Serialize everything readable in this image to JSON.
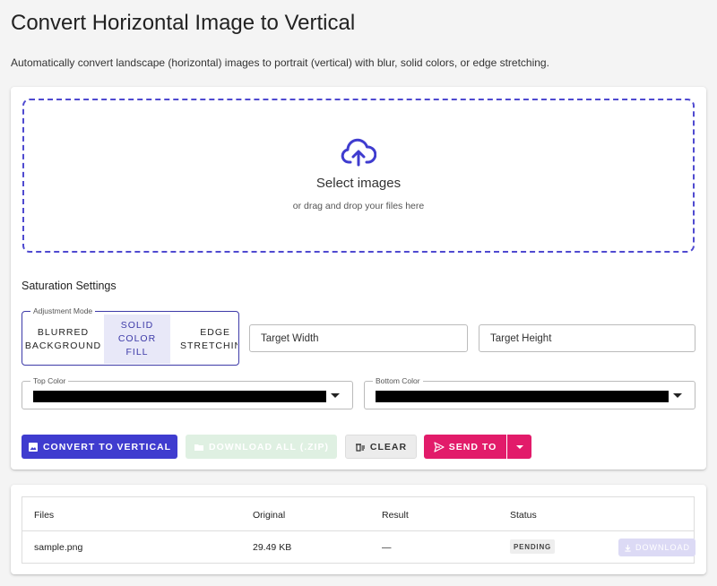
{
  "page": {
    "title": "Convert Horizontal Image to Vertical",
    "subtitle": "Automatically convert landscape (horizontal) images to portrait (vertical) with blur, solid colors, or edge stretching."
  },
  "dropzone": {
    "icon": "cloud-upload-icon",
    "title": "Select images",
    "subtitle": "or drag and drop your files here"
  },
  "settings": {
    "section_label": "Saturation Settings",
    "mode_legend": "Adjustment Mode",
    "modes": [
      {
        "label": "BLURRED\nBACKGROUND",
        "selected": false
      },
      {
        "label": "SOLID\nCOLOR\nFILL",
        "selected": true
      },
      {
        "label": "EDGE\nSTRETCHING",
        "selected": false
      }
    ],
    "target_width_placeholder": "Target Width",
    "target_height_placeholder": "Target Height",
    "top_color_legend": "Top Color",
    "top_color_value": "#000000",
    "bottom_color_legend": "Bottom Color",
    "bottom_color_value": "#000000"
  },
  "actions": {
    "convert_label": "CONVERT TO VERTICAL",
    "download_all_label": "DOWNLOAD ALL (.ZIP)",
    "clear_label": "CLEAR",
    "send_label": "SEND TO"
  },
  "files_table": {
    "headers": [
      "Files",
      "Original",
      "Result",
      "Status"
    ],
    "rows": [
      {
        "file": "sample.png",
        "original": "29.49 KB",
        "result": "—",
        "status": "PENDING",
        "download_label": "DOWNLOAD"
      }
    ]
  },
  "colors": {
    "primary": "#3f3ccf",
    "accent": "#e21b6a",
    "dropzone_border": "#4f4ad0"
  }
}
